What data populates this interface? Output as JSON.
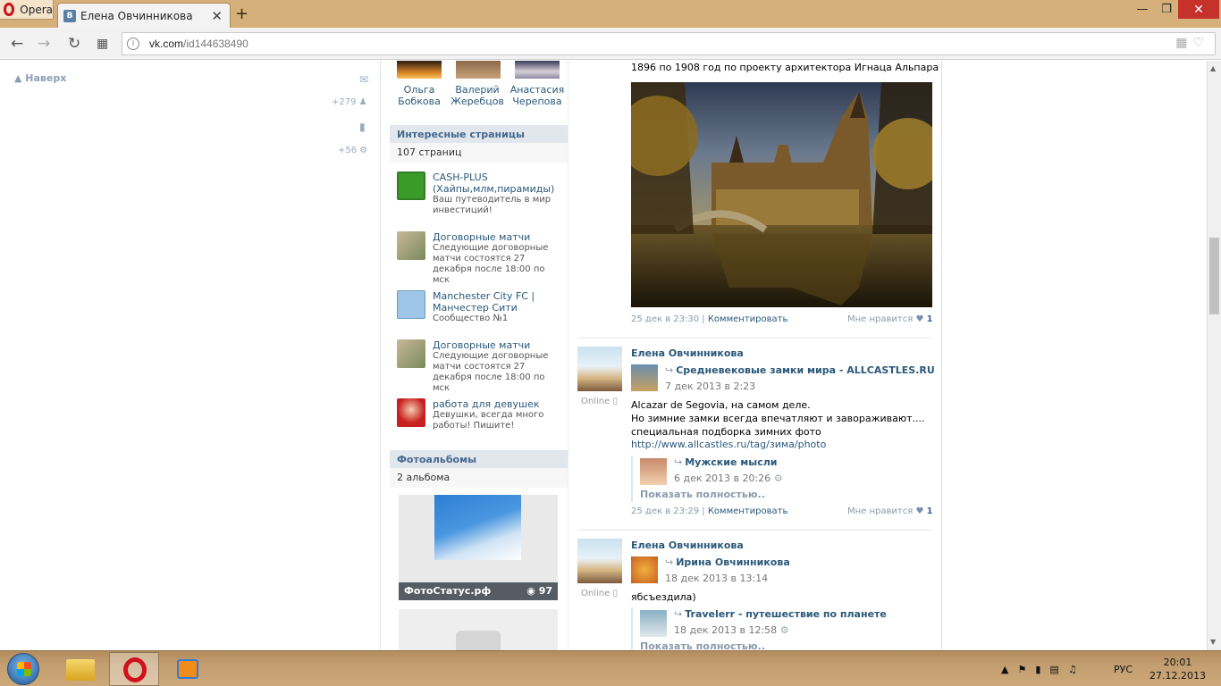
{
  "browser": {
    "opera_label": "Opera",
    "tab_title": "Елена Овчинникова",
    "tab_favicon": "B",
    "url_domain": "vk.com",
    "url_path": "/id144638490"
  },
  "left_panel": {
    "up_label": "Наверх",
    "friends_count": "+279",
    "groups_count": "+56"
  },
  "friends": [
    {
      "first": "Ольга",
      "last": "Бобкова"
    },
    {
      "first": "Валерий",
      "last": "Жеребцов"
    },
    {
      "first": "Анастасия",
      "last": "Черепова"
    }
  ],
  "interesting_pages": {
    "title": "Интересные страницы",
    "count": "107 страниц",
    "items": [
      {
        "name": "CASH-PLUS (Хайпы,млм,пирамиды)",
        "desc": "Ваш путеводитель в мир инвестиций!"
      },
      {
        "name": "Договорные матчи",
        "desc": "Следующие договорные матчи состоятся 27 декабря после 18:00 по мск"
      },
      {
        "name": "Manchester City FC | Манчестер Сити",
        "desc": "Сообщество №1"
      },
      {
        "name": "Договорные матчи",
        "desc": "Следующие договорные матчи состоятся 27 декабря после 18:00 по мск"
      },
      {
        "name": "работа для девушек",
        "desc": "Девушки, всегда много работы! Пишите!"
      }
    ]
  },
  "photo_albums": {
    "title": "Фотоальбомы",
    "count": "2 альбома",
    "album1_name": "ФотоСтатус.рф",
    "album1_count": "97"
  },
  "wall": {
    "post0_text_tail": "1896 по 1908 год по проекту архитектора Игнаца Альпара",
    "post0_date": "25 дек в 23:30",
    "comment_label": "Комментировать",
    "like_label": "Мне нравится",
    "post0_likes": "1",
    "post1": {
      "author": "Елена Овчинникова",
      "online": "Online",
      "repost_from": "Средневековые замки мира - ALLCASTLES.RU",
      "repost_date": "7 дек 2013 в 2:23",
      "lines": [
        "Alcazar de Segovia, на самом деле.",
        "Но зимние замки всегда впечатляют и завораживают....",
        "специальная подборка зимних фото"
      ],
      "link": "http://www.allcastles.ru/tag/зима/photo",
      "nested_from": "Мужские мысли",
      "nested_date": "6 дек 2013 в 20:26",
      "show_more": "Показать полностью..",
      "date": "25 дек в 23:29",
      "likes": "1"
    },
    "post2": {
      "author": "Елена Овчинникова",
      "online": "Online",
      "repost_from": "Ирина Овчинникова",
      "repost_date": "18 дек 2013 в 13:14",
      "text": "ябсъездила)",
      "nested_from": "Travelerr - путешествие по планете",
      "nested_date": "18 дек 2013 в 12:58",
      "show_more": "Показать полностью.."
    }
  },
  "taskbar": {
    "lang": "РУС",
    "time": "20:01",
    "date": "27.12.2013"
  }
}
